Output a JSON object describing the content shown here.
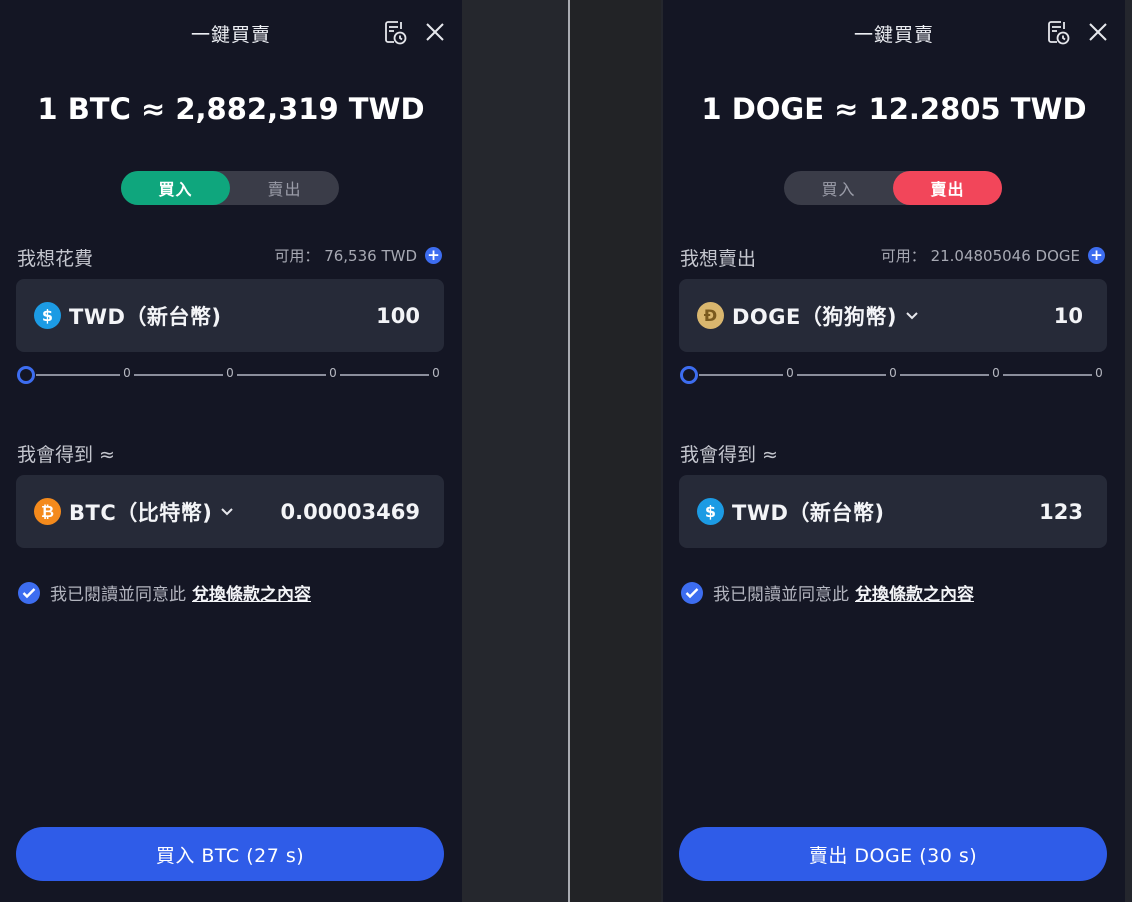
{
  "left": {
    "title": "一鍵買賣",
    "rate": "1 BTC ≈ 2,882,319 TWD",
    "toggle": {
      "buy": "買入",
      "sell": "賣出",
      "active": "buy"
    },
    "from_label": "我想花費",
    "available": "可用： 76,536 TWD",
    "from": {
      "currency": "TWD（新台幣)",
      "icon": "dollar-icon",
      "amount": "100"
    },
    "slider": {
      "ticks": [
        "0",
        "0",
        "0",
        "0"
      ],
      "level": 0
    },
    "to_label": "我會得到 ≈",
    "to": {
      "currency": "BTC（比特幣)",
      "icon": "bitcoin-icon",
      "amount": "0.00003469"
    },
    "agree_text": "我已閱讀並同意此",
    "agree_link": "兌換條款之內容",
    "cta": "買入 BTC (27 s)"
  },
  "right": {
    "title": "一鍵買賣",
    "rate": "1 DOGE ≈ 12.2805 TWD",
    "toggle": {
      "buy": "買入",
      "sell": "賣出",
      "active": "sell"
    },
    "from_label": "我想賣出",
    "available": "可用： 21.04805046 DOGE",
    "from": {
      "currency": "DOGE（狗狗幣)",
      "icon": "doge-icon",
      "amount": "10"
    },
    "slider": {
      "ticks": [
        "0",
        "0",
        "0",
        "0"
      ],
      "level": 0
    },
    "to_label": "我會得到 ≈",
    "to": {
      "currency": "TWD（新台幣)",
      "icon": "dollar-icon",
      "amount": "123"
    },
    "agree_text": "我已閱讀並同意此",
    "agree_link": "兌換條款之內容",
    "cta": "賣出 DOGE (30 s)"
  },
  "colors": {
    "buy": "#0fa67d",
    "sell": "#f2465a",
    "accent": "#3d6df0",
    "cta": "#2f5ce8"
  }
}
